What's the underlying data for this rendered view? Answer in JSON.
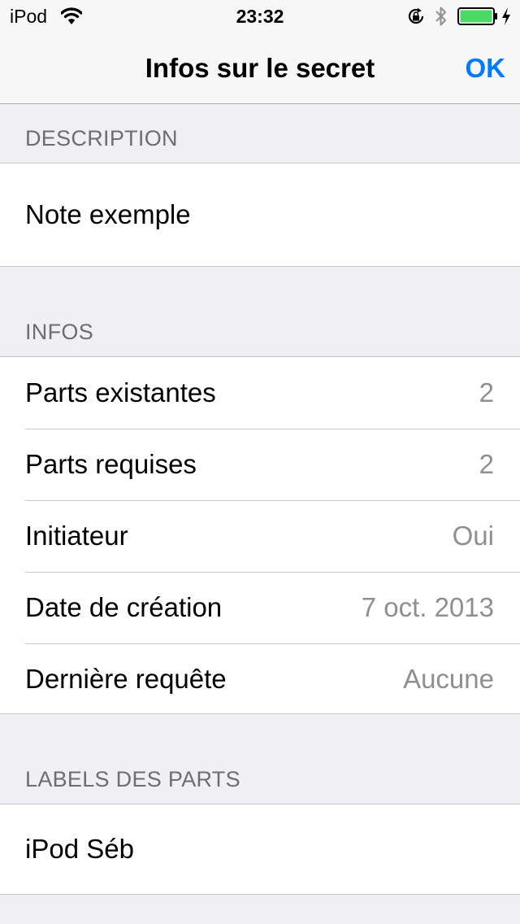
{
  "status_bar": {
    "carrier": "iPod",
    "time": "23:32",
    "battery_level": 1.0,
    "icons": [
      "wifi-icon",
      "orientation-lock-icon",
      "bluetooth-icon",
      "battery-icon",
      "charging-icon"
    ]
  },
  "nav": {
    "title": "Infos sur le secret",
    "done_label": "OK"
  },
  "colors": {
    "accent": "#007aff",
    "background": "#efeff4",
    "section_header": "#6d6d72",
    "value_text": "#8e8e93",
    "battery": "#4cd964"
  },
  "sections": {
    "description": {
      "header": "DESCRIPTION",
      "text": "Note exemple"
    },
    "infos": {
      "header": "INFOS",
      "rows": [
        {
          "label": "Parts existantes",
          "value": "2"
        },
        {
          "label": "Parts requises",
          "value": "2"
        },
        {
          "label": "Initiateur",
          "value": "Oui"
        },
        {
          "label": "Date de création",
          "value": "7 oct. 2013"
        },
        {
          "label": "Dernière requête",
          "value": "Aucune"
        }
      ]
    },
    "labels": {
      "header": "LABELS DES PARTS",
      "items": [
        "iPod Séb"
      ]
    }
  }
}
